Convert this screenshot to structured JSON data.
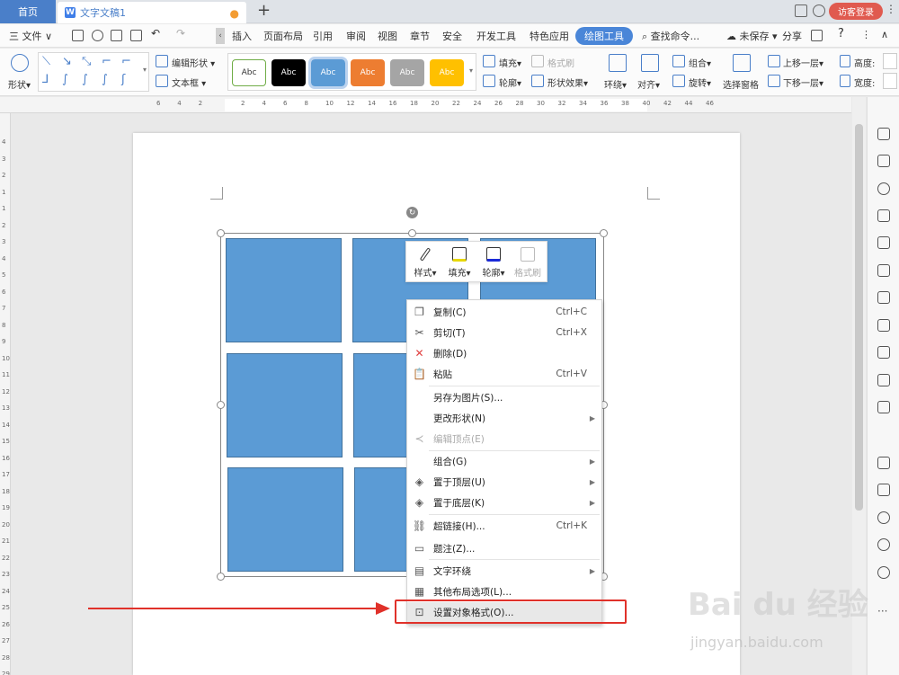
{
  "titlebar": {
    "home_tab": "首页",
    "doc_tab": "文字文稿1",
    "doc_icon": "W",
    "unsaved_dot": "●",
    "new_tab": "+",
    "login": "访客登录",
    "more": "⋮"
  },
  "menubar": {
    "file": "三 文件 ∨",
    "items": [
      "插入",
      "页面布局",
      "引用",
      "审阅",
      "视图",
      "章节",
      "安全",
      "开发工具",
      "特色应用"
    ],
    "active": "绘图工具",
    "search": "查找命令...",
    "unsaved": "未保存 ▾",
    "share": "分享",
    "help": "?",
    "more": "⋮",
    "collapse": "‹"
  },
  "ribbon": {
    "shape": "形状",
    "edit_shape": "编辑形状",
    "textbox": "文本框",
    "style_text": "Abc",
    "swatches": [
      "#ffffff",
      "#000000",
      "#5b9bd5",
      "#ed7d31",
      "#a5a5a5",
      "#ffc000"
    ],
    "swatch_text_colors": [
      "#333333",
      "#ffffff",
      "#ffffff",
      "#ffffff",
      "#ffffff",
      "#ffffff"
    ],
    "fill": "填充",
    "outline": "轮廓",
    "format_brush": "格式刷",
    "shape_effect": "形状效果",
    "wrap": "环绕",
    "align": "对齐",
    "group": "组合",
    "rotate": "旋转",
    "selection_pane": "选择窗格",
    "bring_forward": "上移一层",
    "send_backward": "下移一层",
    "height": "高度:",
    "width": "宽度:"
  },
  "ruler": {
    "h_numbers": [
      "6",
      "4",
      "2",
      "2",
      "4",
      "6",
      "8",
      "10",
      "12",
      "14",
      "16",
      "18",
      "20",
      "22",
      "24",
      "26",
      "28",
      "30",
      "32",
      "34",
      "36",
      "38",
      "40",
      "42",
      "44",
      "46"
    ],
    "v_numbers": [
      "4",
      "3",
      "2",
      "1",
      "1",
      "2",
      "3",
      "4",
      "5",
      "6",
      "7",
      "8",
      "9",
      "10",
      "11",
      "12",
      "13",
      "14",
      "15",
      "16",
      "17",
      "18",
      "19",
      "20",
      "21",
      "22",
      "23",
      "24",
      "25",
      "26",
      "27",
      "28",
      "29"
    ]
  },
  "mini_toolbar": {
    "style": "样式",
    "fill": "填充",
    "outline": "轮廓",
    "brush": "格式刷"
  },
  "context_menu": {
    "copy": "复制(C)",
    "copy_key": "Ctrl+C",
    "cut": "剪切(T)",
    "cut_key": "Ctrl+X",
    "delete": "删除(D)",
    "paste": "粘贴",
    "paste_key": "Ctrl+V",
    "save_as_image": "另存为图片(S)...",
    "change_shape": "更改形状(N)",
    "edit_points": "编辑顶点(E)",
    "group": "组合(G)",
    "bring_front": "置于顶层(U)",
    "send_back": "置于底层(K)",
    "hyperlink": "超链接(H)...",
    "hyperlink_key": "Ctrl+K",
    "caption": "题注(Z)...",
    "text_wrap": "文字环绕",
    "more_layout": "其他布局选项(L)...",
    "format_object": "设置对象格式(O)..."
  },
  "watermark": {
    "brand": "Bai du 经验",
    "url": "jingyan.baidu.com"
  }
}
